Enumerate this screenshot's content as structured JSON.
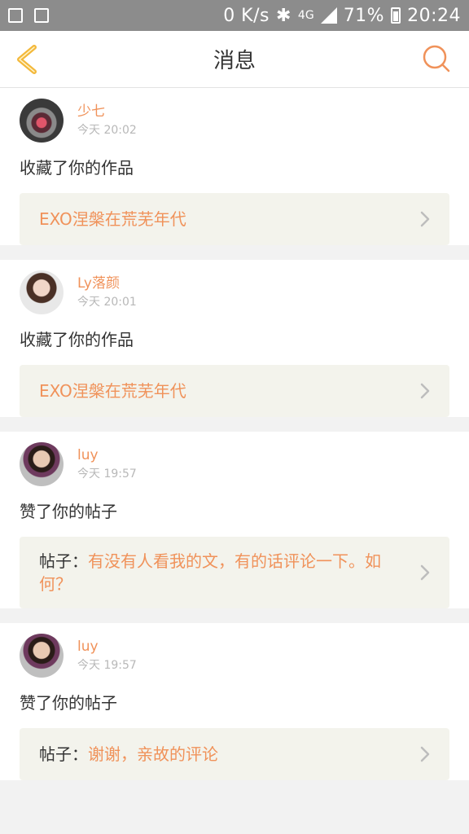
{
  "status_bar": {
    "speed": "0 K/s",
    "network": "4G",
    "battery": "71%",
    "time": "20:24",
    "icons": [
      "image-icon",
      "recycle-icon",
      "bluetooth-icon",
      "signal-icon",
      "battery-icon"
    ]
  },
  "header": {
    "title": "消息",
    "back_icon": "chevron-left-icon",
    "search_icon": "search-icon"
  },
  "colors": {
    "accent": "#f0925a",
    "back_icon": "#f3b83a",
    "box_bg": "#f3f3ec"
  },
  "messages": [
    {
      "user": "少七",
      "time": "今天 20:02",
      "action": "收藏了你的作品",
      "prefix": "",
      "content": "EXO涅槃在荒芜年代"
    },
    {
      "user": "Ly落颜",
      "time": "今天 20:01",
      "action": "收藏了你的作品",
      "prefix": "",
      "content": "EXO涅槃在荒芜年代"
    },
    {
      "user": "luy",
      "time": "今天 19:57",
      "action": "赞了你的帖子",
      "prefix": "帖子：",
      "content": "有没有人看我的文，有的话评论一下。如何？"
    },
    {
      "user": "luy",
      "time": "今天 19:57",
      "action": "赞了你的帖子",
      "prefix": "帖子：",
      "content": "谢谢，亲故的评论"
    }
  ]
}
